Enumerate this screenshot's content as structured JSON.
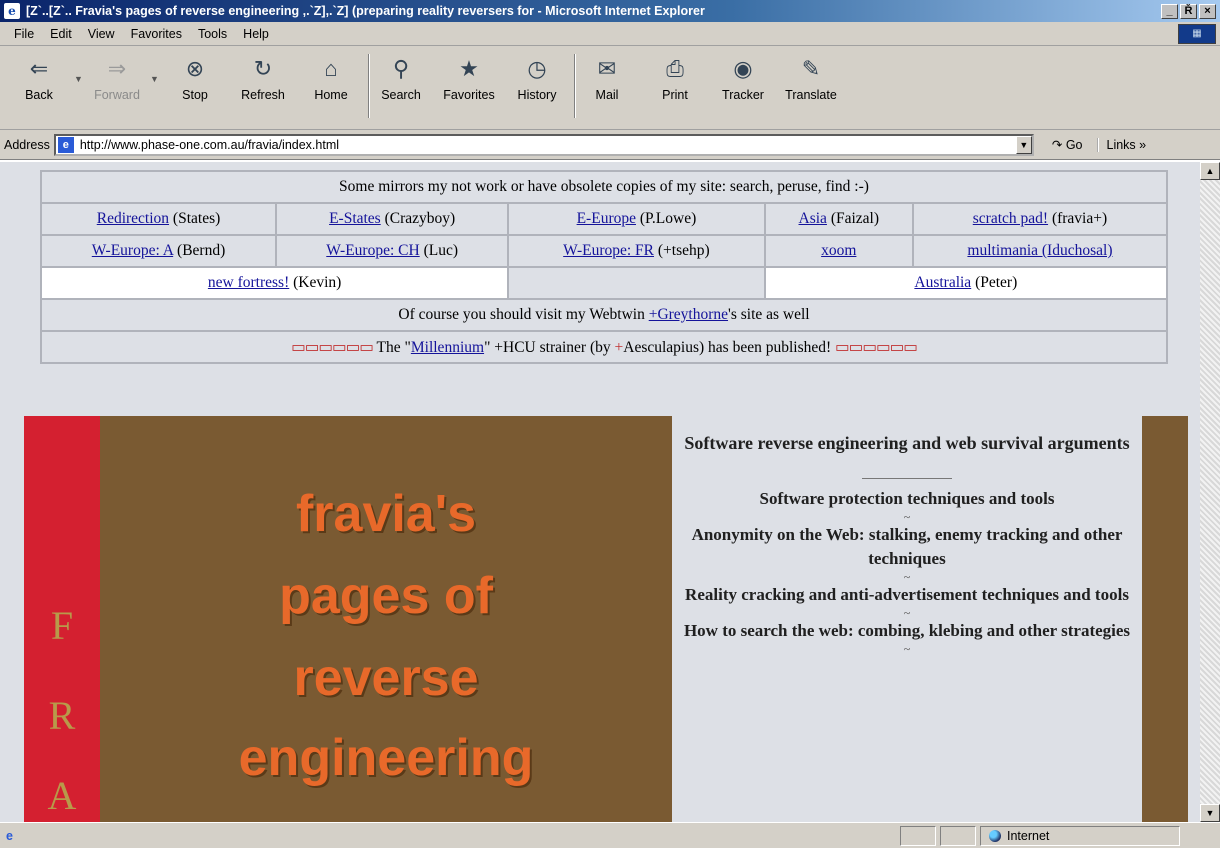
{
  "window": {
    "title": "[Z`..[Z`.. Fravia's pages of reverse engineering ,.`Z],.`Z] (preparing reality reversers for - Microsoft Internet Explorer",
    "controls": [
      "_",
      "Ř",
      "×"
    ]
  },
  "menu": [
    "File",
    "Edit",
    "View",
    "Favorites",
    "Tools",
    "Help"
  ],
  "toolbar": {
    "back": "Back",
    "forward": "Forward",
    "stop": "Stop",
    "refresh": "Refresh",
    "home": "Home",
    "search": "Search",
    "favorites": "Favorites",
    "history": "History",
    "mail": "Mail",
    "print": "Print",
    "tracker": "Tracker",
    "translate": "Translate"
  },
  "address": {
    "label": "Address",
    "url": "http://www.phase-one.com.au/fravia/index.html",
    "go": "Go",
    "links": "Links »"
  },
  "mirrors": {
    "intro": "Some mirrors my not work or have obsolete copies of my site: search, peruse, find :-)",
    "row1": [
      {
        "link": "Redirection",
        "note": " (States)"
      },
      {
        "link": "E-States",
        "note": " (Crazyboy)"
      },
      {
        "link": "E-Europe",
        "note": " (P.Lowe)"
      },
      {
        "link": "Asia",
        "note": " (Faizal)"
      },
      {
        "link": "scratch pad!",
        "note": " (fravia+)"
      }
    ],
    "row2": [
      {
        "link": "W-Europe: A",
        "note": " (Bernd)"
      },
      {
        "link": "W-Europe: CH",
        "note": " (Luc)"
      },
      {
        "link": "W-Europe: FR",
        "note": " (+tsehp)"
      },
      {
        "link": "xoom",
        "note": ""
      },
      {
        "link": "multimania (Iduchosal)",
        "note": ""
      }
    ],
    "row3": [
      {
        "link": "new fortress!",
        "note": " (Kevin)"
      },
      {
        "link": "Australia",
        "note": " (Peter)"
      }
    ],
    "webtwin": {
      "before": "Of course you should visit my Webtwin ",
      "link": "+Greythorne",
      "after": "'s site as well"
    },
    "millennium": {
      "glyphs": "▭▭▭▭▭▭",
      "before": " The \"",
      "link": "Millennium",
      "middle": "\" +HCU strainer (by ",
      "plus": "+",
      "after": "Aesculapius) has been published! "
    }
  },
  "banner": {
    "letters": [
      "F",
      "R",
      "A"
    ],
    "words": [
      "fravia's",
      "pages of",
      "reverse",
      "engineering"
    ]
  },
  "topics": {
    "heading": "Software reverse engineering and web survival arguments",
    "items": [
      "Software protection techniques and tools",
      "Anonymity on the Web: stalking, enemy tracking and other techniques",
      "Reality cracking and anti-advertisement techniques and tools",
      "How to search the web: combing, klebing and other strategies"
    ],
    "separator": "~"
  },
  "status": {
    "zone": "Internet"
  },
  "colors": {
    "link": "#14139a",
    "banner_red": "#d42030",
    "banner_brown": "#7a5a32",
    "banner_text": "#e8692a",
    "page_bg": "#dde0e6"
  }
}
